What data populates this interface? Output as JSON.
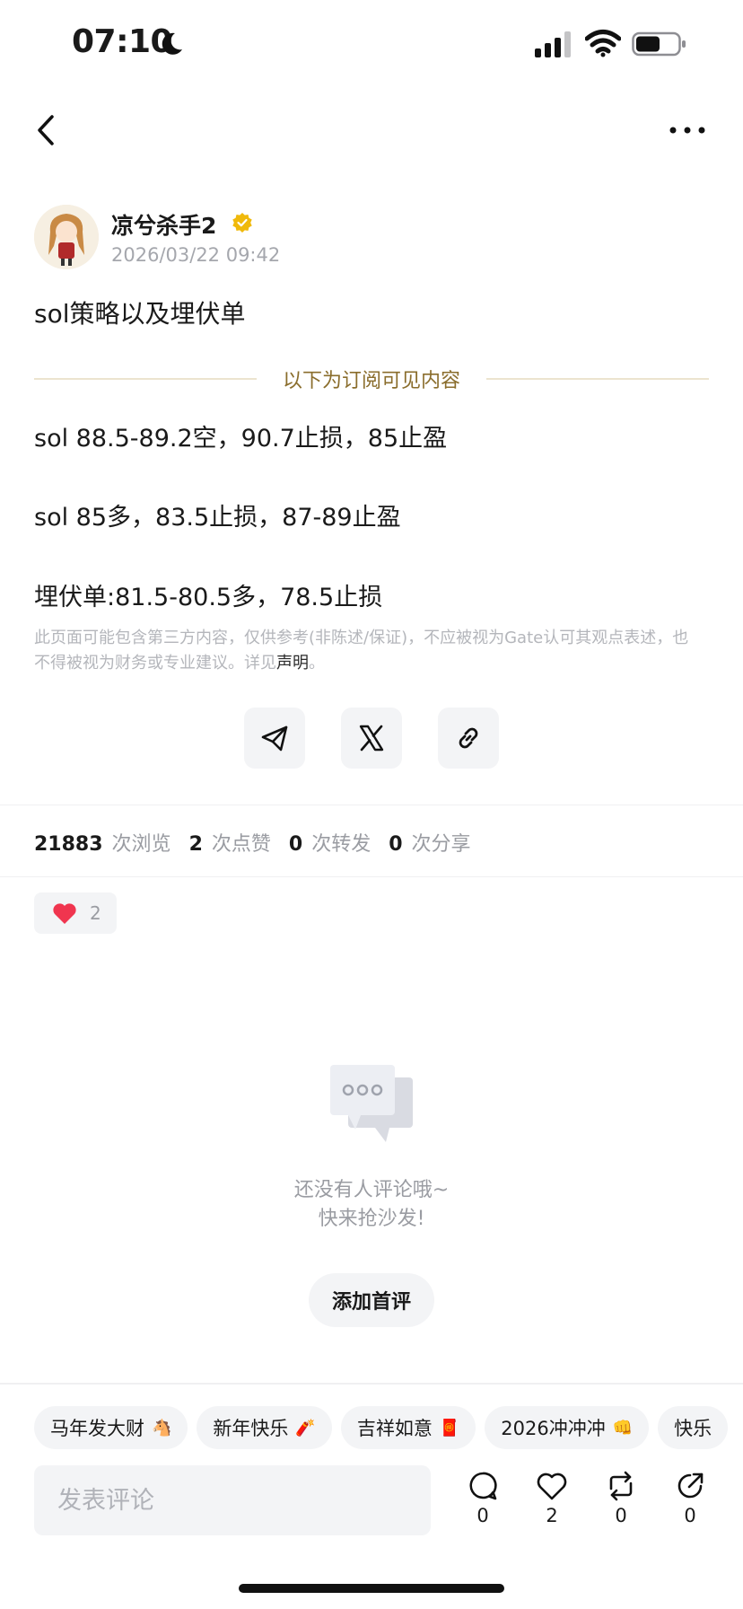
{
  "status_bar": {
    "time": "07:10",
    "icons": [
      "moon-icon",
      "signal-icon",
      "wifi-icon",
      "battery-icon"
    ]
  },
  "nav": {
    "back_icon": "back-icon",
    "more_icon": "more-icon"
  },
  "post": {
    "author": "凉兮杀手2",
    "timestamp": "2026/03/22 09:42",
    "title": "sol策略以及埋伏单",
    "subscriber_divider": "以下为订阅可见内容",
    "lines": [
      "sol 88.5-89.2空，90.7止损，85止盈",
      "sol 85多，83.5止损，87-89止盈",
      "埋伏单:81.5-80.5多，78.5止损"
    ],
    "disclaimer_text": "此页面可能包含第三方内容，仅供参考(非陈述/保证)，不应被视为Gate认可其观点表述，也不得被视为财务或专业建议。详见",
    "disclaimer_link": "声明",
    "disclaimer_end": "。"
  },
  "share_buttons": [
    "telegram-icon",
    "x-icon",
    "link-icon"
  ],
  "stats": {
    "views": "21883",
    "views_label": "次浏览",
    "likes": "2",
    "likes_label": "次点赞",
    "reposts": "0",
    "reposts_label": "次转发",
    "shares": "0",
    "shares_label": "次分享"
  },
  "reaction": {
    "icon": "heart-icon",
    "count": "2"
  },
  "comments_empty": {
    "line1": "还没有人评论哦~",
    "line2": "快来抢沙发!",
    "button": "添加首评"
  },
  "quick_tags": [
    {
      "label": "马年发大财",
      "emoji": "🐴"
    },
    {
      "label": "新年快乐",
      "emoji": "🧨"
    },
    {
      "label": "吉祥如意",
      "emoji": "🧧"
    },
    {
      "label": "2026冲冲冲",
      "emoji": "👊"
    },
    {
      "label": "快乐",
      "emoji": ""
    }
  ],
  "bottom_bar": {
    "comment_placeholder": "发表评论",
    "comment_count": "0",
    "like_count": "2",
    "repost_count": "0",
    "share_count": "0"
  },
  "colors": {
    "accent_gold": "#8a6d2c",
    "verified_gold": "#f0b90b",
    "heart_red": "#f0354f"
  }
}
